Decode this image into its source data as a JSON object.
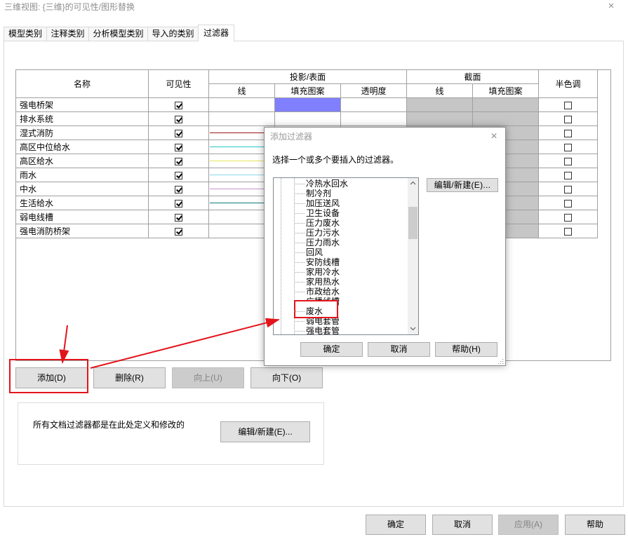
{
  "window": {
    "title": "三维视图: {三维}的可见性/图形替换",
    "close_glyph": "×"
  },
  "tabs": [
    {
      "label": "模型类别",
      "active": false
    },
    {
      "label": "注释类别",
      "active": false
    },
    {
      "label": "分析模型类别",
      "active": false
    },
    {
      "label": "导入的类别",
      "active": false
    },
    {
      "label": "过滤器",
      "active": true
    }
  ],
  "filter_table": {
    "headers": {
      "name": "名称",
      "visibility": "可见性",
      "projection_group": "投影/表面",
      "projection_line": "线",
      "projection_fill": "填充图案",
      "projection_transparency": "透明度",
      "cut_group": "截面",
      "cut_line": "线",
      "cut_fill": "填充图案",
      "halftone": "半色调"
    },
    "rows": [
      {
        "name": "强电桥架",
        "visible": true,
        "projection_line_color": null,
        "projection_fill_color": "#8080ff",
        "halftone": false
      },
      {
        "name": "排水系统",
        "visible": true,
        "projection_line_color": null,
        "projection_fill_color": null,
        "halftone": false
      },
      {
        "name": "湿式消防",
        "visible": true,
        "projection_line_color": "#a01818",
        "projection_fill_color": null,
        "halftone": false
      },
      {
        "name": "高区中位给水",
        "visible": true,
        "projection_line_color": "#26c6c6",
        "projection_fill_color": null,
        "halftone": false
      },
      {
        "name": "高区给水",
        "visible": true,
        "projection_line_color": "#e6e65a",
        "projection_fill_color": null,
        "halftone": false
      },
      {
        "name": "雨水",
        "visible": true,
        "projection_line_color": "#8ad8ec",
        "projection_fill_color": null,
        "halftone": false
      },
      {
        "name": "中水",
        "visible": true,
        "projection_line_color": "#c890d0",
        "projection_fill_color": null,
        "halftone": false
      },
      {
        "name": "生活给水",
        "visible": true,
        "projection_line_color": "#107c7c",
        "projection_fill_color": null,
        "halftone": false
      },
      {
        "name": "弱电线槽",
        "visible": true,
        "projection_line_color": null,
        "projection_fill_color": null,
        "halftone": false
      },
      {
        "name": "强电消防桥架",
        "visible": true,
        "projection_line_color": null,
        "projection_fill_color": null,
        "halftone": false
      }
    ]
  },
  "actions": {
    "add": "添加(D)",
    "delete": "删除(R)",
    "move_up": "向上(U)",
    "move_down": "向下(O)",
    "move_up_enabled": false
  },
  "filters_note": {
    "text": "所有文档过滤器都是在此处定义和修改的",
    "edit_button": "编辑/新建(E)..."
  },
  "footer": {
    "ok": "确定",
    "cancel": "取消",
    "apply": "应用(A)",
    "help": "帮助",
    "apply_enabled": false
  },
  "add_filter_dialog": {
    "title": "添加过滤器",
    "close_glyph": "×",
    "instruction": "选择一个或多个要插入的过滤器。",
    "items": [
      {
        "label": "冷热水回水"
      },
      {
        "label": "制冷剂"
      },
      {
        "label": "加压送风"
      },
      {
        "label": "卫生设备"
      },
      {
        "label": "压力废水"
      },
      {
        "label": "压力污水"
      },
      {
        "label": "压力雨水"
      },
      {
        "label": "回风"
      },
      {
        "label": "安防线槽"
      },
      {
        "label": "家用冷水"
      },
      {
        "label": "家用热水"
      },
      {
        "label": "市政给水"
      },
      {
        "label": "广播线槽"
      },
      {
        "label": "废水",
        "annotated": true
      },
      {
        "label": "弱电套管"
      },
      {
        "label": "强电套管"
      }
    ],
    "edit_button": "编辑/新建(E)...",
    "ok": "确定",
    "cancel": "取消",
    "help": "帮助(H)"
  },
  "colors": {
    "annotation": "#e3141b",
    "hatch_dark": "#a3a3a3",
    "hatch_light": "#e8e8e8"
  }
}
